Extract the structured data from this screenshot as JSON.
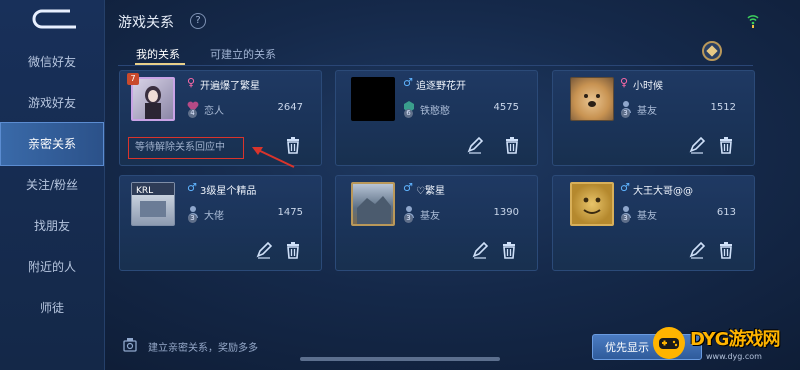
{
  "header": {
    "title": "游戏关系",
    "help": "?"
  },
  "sidebar": {
    "items": [
      {
        "label": "微信好友"
      },
      {
        "label": "游戏好友"
      },
      {
        "label": "亲密关系"
      },
      {
        "label": "关注/粉丝"
      },
      {
        "label": "找朋友"
      },
      {
        "label": "附近的人"
      },
      {
        "label": "师徒"
      }
    ]
  },
  "tabs": [
    {
      "label": "我的关系"
    },
    {
      "label": "可建立的关系"
    }
  ],
  "cards": [
    {
      "gender": "♀",
      "name": "开遍爆了繁星",
      "rel_level": "4",
      "rel_name": "恋人",
      "points": "2647",
      "pending": "等待解除关系回应中"
    },
    {
      "gender": "♂",
      "name": "追逐野花开",
      "rel_level": "6",
      "rel_name": "铁憨憨",
      "points": "4575"
    },
    {
      "gender": "♀",
      "name": "小时候",
      "rel_level": "3",
      "rel_name": "基友",
      "points": "1512"
    },
    {
      "gender": "♂",
      "name": "3级星个精品",
      "rel_level": "3",
      "rel_name": "大佬",
      "points": "1475"
    },
    {
      "gender": "♂",
      "name": "♡繁星",
      "rel_level": "3",
      "rel_name": "基友",
      "points": "1390"
    },
    {
      "gender": "♂",
      "name": "大王大哥@@",
      "rel_level": "3",
      "rel_name": "基友",
      "points": "613"
    }
  ],
  "footer": {
    "tip": "建立亲密关系，奖励多多",
    "priority_button": "优先显示"
  },
  "watermark": {
    "text": "DYG游戏网",
    "url": "www.dyg.com"
  },
  "colors": {
    "accent": "#e9d08a",
    "male": "#5fb4ff",
    "female": "#ff6aa8",
    "pending_border": "#d9342b"
  }
}
